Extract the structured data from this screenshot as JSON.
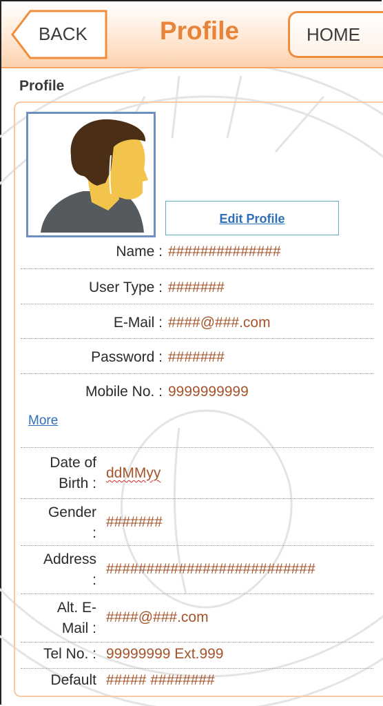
{
  "header": {
    "back_label": "BACK",
    "title": "Profile",
    "home_label": "HOME"
  },
  "section_title": "Profile",
  "edit_profile_label": "Edit Profile",
  "fields": {
    "name": {
      "label": "Name :",
      "value": "##############"
    },
    "user_type": {
      "label": "User Type :",
      "value": "#######"
    },
    "email": {
      "label": "E-Mail :",
      "value": "####@###.com"
    },
    "password": {
      "label": "Password :",
      "value": "#######"
    },
    "mobile": {
      "label": "Mobile No. :",
      "value": "9999999999"
    }
  },
  "more_label": "More",
  "more_fields": {
    "dob": {
      "label_line1": "Date of",
      "label_line2": "Birth :",
      "value": "ddMMyy"
    },
    "gender": {
      "label_line1": "Gender",
      "label_line2": ":",
      "value": "#######"
    },
    "address": {
      "label_line1": "Address",
      "label_line2": ":",
      "value": "##########################"
    },
    "alt_email": {
      "label_line1": "Alt. E-",
      "label_line2": "Mail :",
      "value": "####@###.com"
    },
    "tel": {
      "label": "Tel No. :",
      "value": "99999999 Ext.999"
    },
    "default": {
      "label": "Default",
      "value": "##### ########"
    }
  },
  "colors": {
    "accent": "#e8843a",
    "value_text": "#a4542a",
    "link": "#2f6fbd",
    "avatar_border": "#6e8fc0"
  }
}
